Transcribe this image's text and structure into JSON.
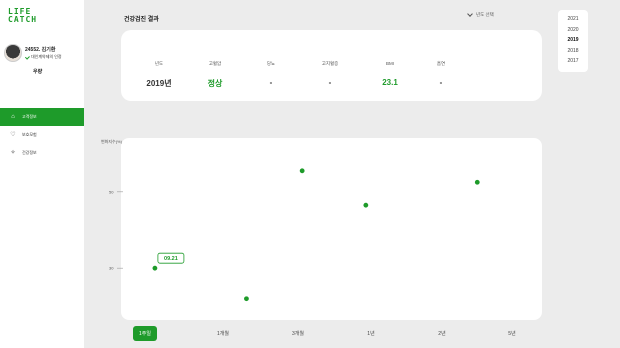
{
  "logo": {
    "line1": "LIFE",
    "line2": "CATCH"
  },
  "user": {
    "name": "24552. 김기환",
    "verify_text": "대인계약제의 인정",
    "grade": "우량"
  },
  "nav": [
    {
      "label": "고객정보",
      "icon": "home-icon",
      "active": true
    },
    {
      "label": "보호모험",
      "icon": "heart-icon",
      "active": false
    },
    {
      "label": "건강정보",
      "icon": "health-icon",
      "active": false
    }
  ],
  "header": {
    "title": "건강검진 결과",
    "year_select_label": "년도 선택"
  },
  "year_options": [
    "2021",
    "2020",
    "2019",
    "2018",
    "2017"
  ],
  "selected_year": "2019",
  "summary": {
    "columns": [
      {
        "head": "년도",
        "value": "2019년",
        "highlight": false
      },
      {
        "head": "고혈압",
        "value": "정상",
        "highlight": true
      },
      {
        "head": "당뇨",
        "value": "-",
        "highlight": false
      },
      {
        "head": "고지혈증",
        "value": "-",
        "highlight": false
      },
      {
        "head": "BMI",
        "value": "23.1",
        "highlight": true
      },
      {
        "head": "흡연",
        "value": "-",
        "highlight": false
      }
    ]
  },
  "chart_data": {
    "type": "scatter",
    "ylabel": "변화지수(%)",
    "yticks": [
      50,
      30
    ],
    "ylim": [
      18,
      62
    ],
    "xlim": [
      0,
      1
    ],
    "grid": false,
    "legend": "none",
    "color": "#1e9b2a",
    "points": [
      {
        "x": 0.05,
        "y": 30,
        "label": "09.21"
      },
      {
        "x": 0.28,
        "y": 22
      },
      {
        "x": 0.42,
        "y": 55.5
      },
      {
        "x": 0.58,
        "y": 46.5
      },
      {
        "x": 0.86,
        "y": 52.5
      }
    ]
  },
  "range_tabs": [
    "1주일",
    "1개월",
    "3개월",
    "1년",
    "2년",
    "5년"
  ],
  "active_range": "1주일",
  "colors": {
    "accent": "#1e9b2a",
    "background": "#ececec"
  }
}
